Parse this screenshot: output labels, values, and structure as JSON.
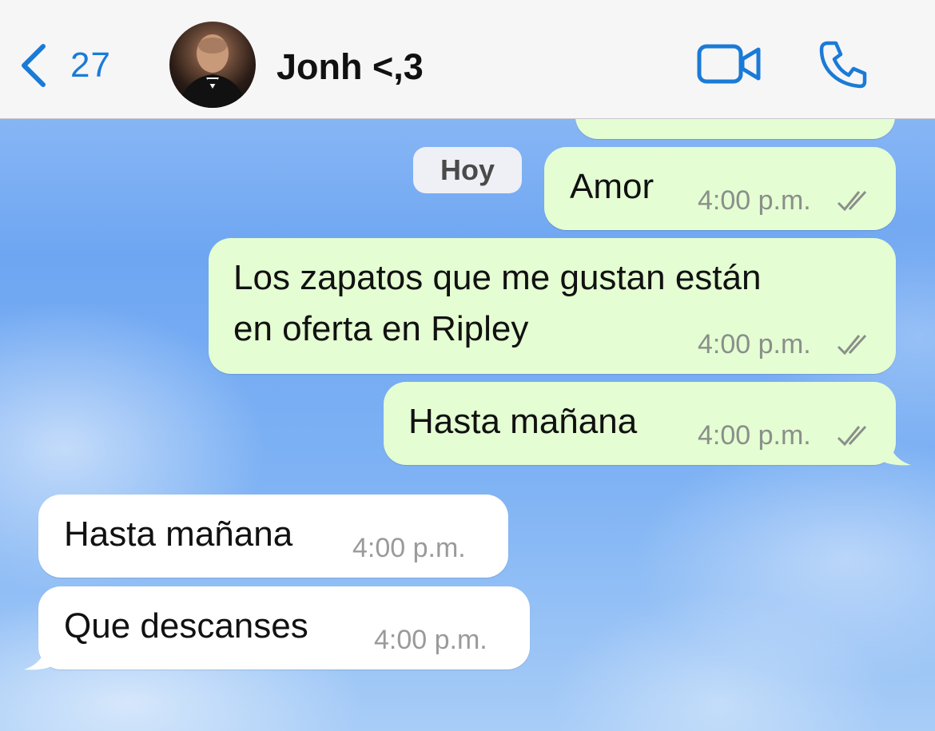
{
  "header": {
    "back_count": "27",
    "contact_name": "Jonh <,3",
    "accent_color": "#1a7bd6",
    "icons": [
      "back-chevron-icon",
      "video-camera-icon",
      "phone-icon"
    ]
  },
  "date_separator": "Hoy",
  "messages": [
    {
      "direction": "outgoing",
      "text": "Amor",
      "time": "4:00 p.m.",
      "status": "read-double-check"
    },
    {
      "direction": "outgoing",
      "text": "Los zapatos que me gustan están\nen oferta en Ripley",
      "time": "4:00 p.m.",
      "status": "read-double-check"
    },
    {
      "direction": "outgoing",
      "text": "Hasta mañana",
      "time": "4:00 p.m.",
      "status": "read-double-check"
    },
    {
      "direction": "incoming",
      "text": "Hasta mañana",
      "time": "4:00 p.m."
    },
    {
      "direction": "incoming",
      "text": "Que descanses",
      "time": "4:00 p.m."
    }
  ],
  "colors": {
    "outgoing_bubble": "#e4fdd2",
    "incoming_bubble": "#ffffff",
    "header_bg": "#f6f6f7"
  }
}
